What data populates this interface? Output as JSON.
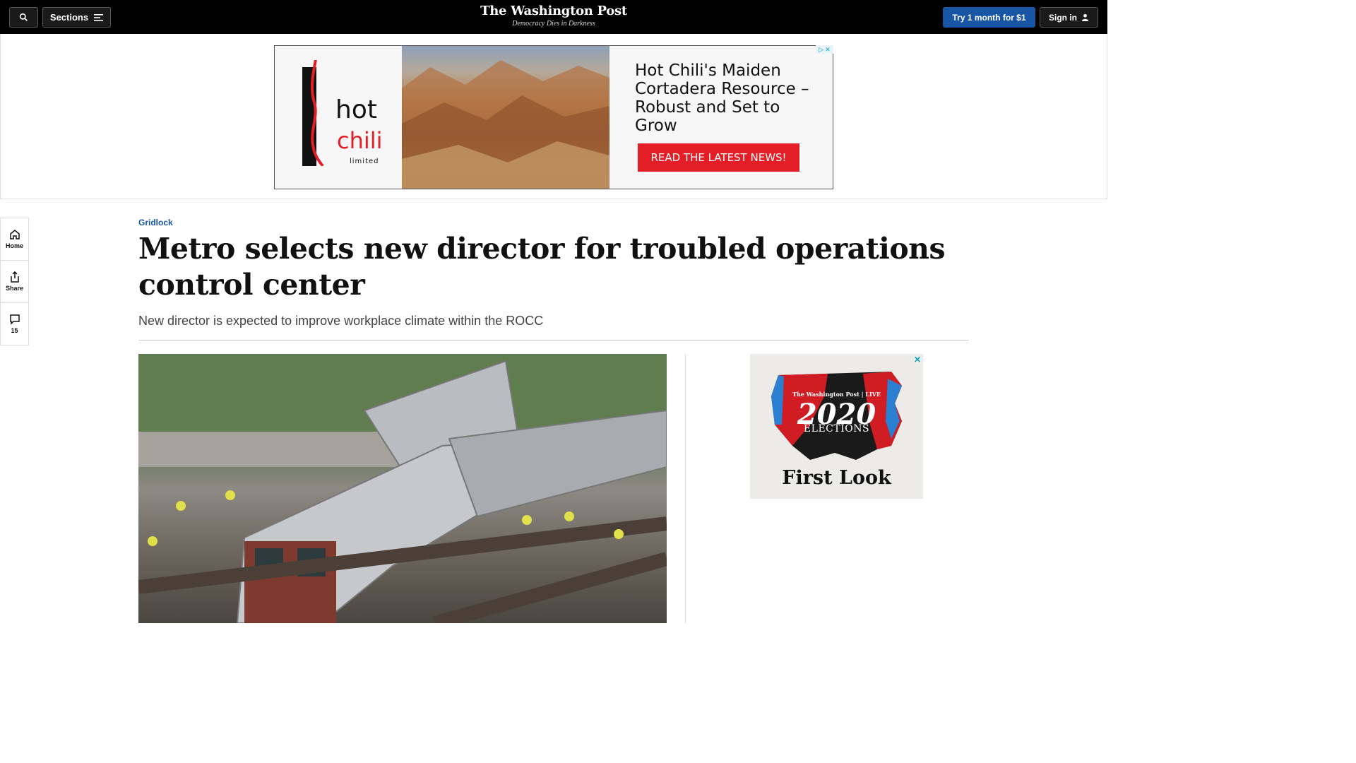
{
  "header": {
    "sections_label": "Sections",
    "logo": "The Washington Post",
    "tagline": "Democracy Dies in Darkness",
    "try_label": "Try 1 month for $1",
    "signin_label": "Sign in"
  },
  "top_ad": {
    "brand_line1": "hot",
    "brand_line2": "chili",
    "brand_line3": "limited",
    "headline": "Hot Chili's Maiden Cortadera Resource – Robust and Set to Grow",
    "cta": "READ THE LATEST NEWS!"
  },
  "side_rail": {
    "home": "Home",
    "share": "Share",
    "comments_count": "15"
  },
  "article": {
    "kicker": "Gridlock",
    "headline": "Metro selects new director for troubled operations control center",
    "dek": "New director is expected to improve workplace climate within the ROCC"
  },
  "side_ad": {
    "brand": "The Washington Post | LIVE",
    "year": "2020",
    "event": "ELECTIONS",
    "tagline": "First Look"
  },
  "colors": {
    "accent_blue": "#1955a5",
    "ad_red": "#e41e26",
    "topbar": "#000000"
  }
}
